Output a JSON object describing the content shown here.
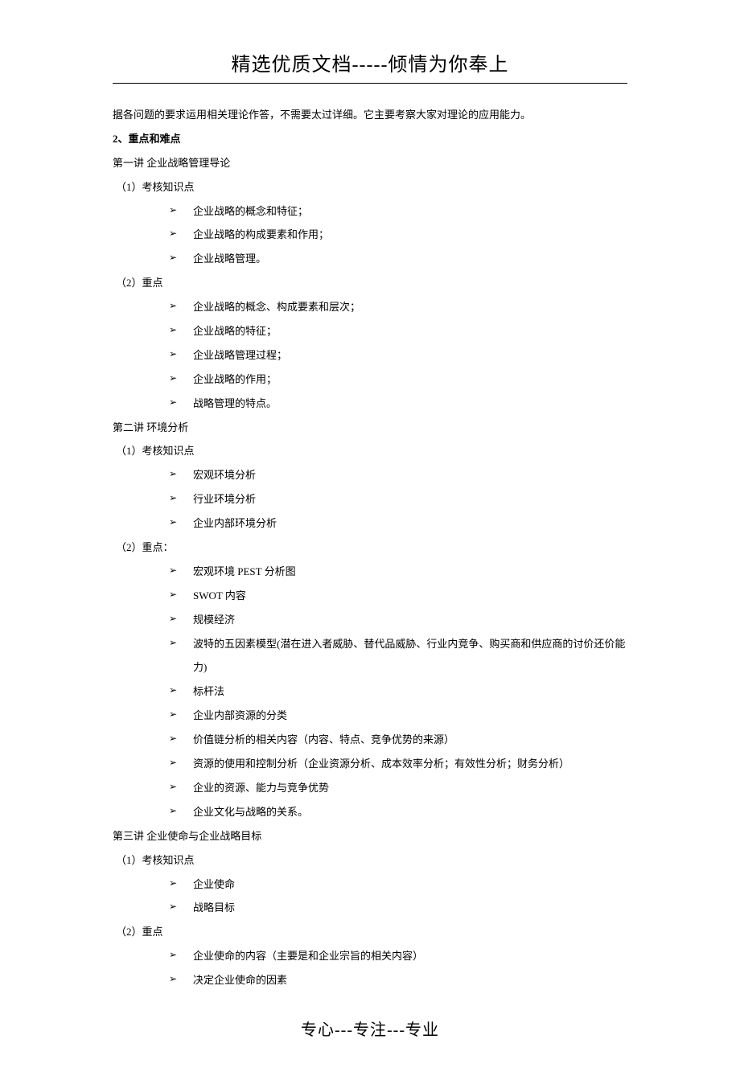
{
  "header": "精选优质文档-----倾情为你奉上",
  "footer": "专心---专注---专业",
  "intro": "据各问题的要求运用相关理论作答，不需要太过详细。它主要考察大家对理论的应用能力。",
  "sectionLabel": "2、重点和难点",
  "lectures": [
    {
      "title": "第一讲 企业战略管理导论",
      "groups": [
        {
          "label": "（1）考核知识点",
          "items": [
            "企业战略的概念和特征；",
            "企业战略的构成要素和作用；",
            "企业战略管理。"
          ]
        },
        {
          "label": "（2）重点",
          "items": [
            "企业战略的概念、构成要素和层次；",
            "企业战略的特征；",
            "企业战略管理过程；",
            "企业战略的作用；",
            "战略管理的特点。"
          ]
        }
      ]
    },
    {
      "title": "第二讲 环境分析",
      "groups": [
        {
          "label": "（1）考核知识点",
          "items": [
            "宏观环境分析",
            "行业环境分析",
            "企业内部环境分析"
          ]
        },
        {
          "label": "（2）重点：",
          "items": [
            "宏观环境 PEST 分析图",
            "SWOT 内容",
            "规模经济",
            "波特的五因素模型(潜在进入者威胁、替代品威胁、行业内竞争、购买商和供应商的讨价还价能力)",
            "标杆法",
            "企业内部资源的分类",
            "价值链分析的相关内容（内容、特点、竞争优势的来源）",
            "资源的使用和控制分析（企业资源分析、成本效率分析；有效性分析；财务分析）",
            "企业的资源、能力与竞争优势",
            "企业文化与战略的关系。"
          ]
        }
      ]
    },
    {
      "title": "第三讲 企业使命与企业战略目标",
      "groups": [
        {
          "label": "（1）考核知识点",
          "items": [
            "企业使命",
            "战略目标"
          ]
        },
        {
          "label": "（2）重点",
          "items": [
            "企业使命的内容（主要是和企业宗旨的相关内容）",
            "决定企业使命的因素"
          ]
        }
      ]
    }
  ]
}
